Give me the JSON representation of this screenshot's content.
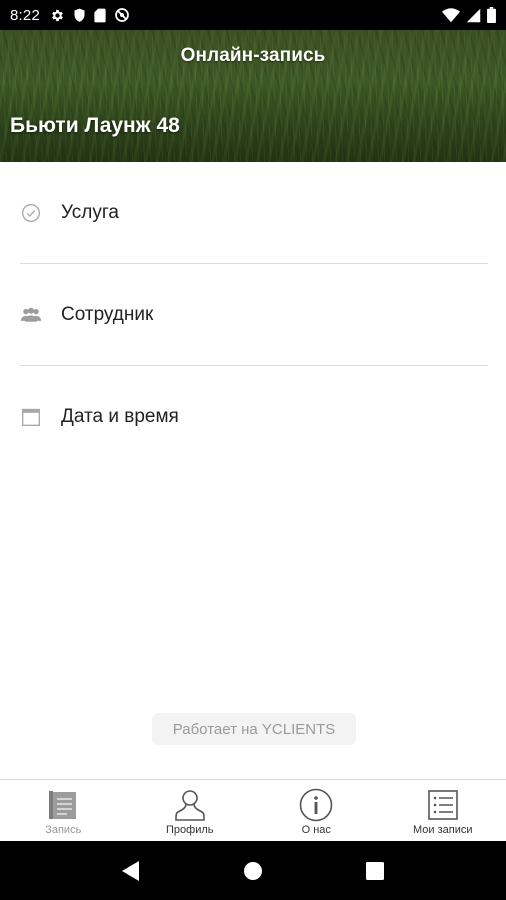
{
  "status_bar": {
    "time": "8:22",
    "left_icons": [
      "gear-icon",
      "shield-icon",
      "sd-card-icon",
      "no-sim-icon"
    ],
    "right_icons": [
      "wifi-icon",
      "signal-icon",
      "battery-icon"
    ]
  },
  "header": {
    "title": "Онлайн-запись",
    "company_name": "Бьюти Лаунж 48"
  },
  "menu": {
    "items": [
      {
        "label": "Услуга",
        "icon": "check-circle-icon"
      },
      {
        "label": "Сотрудник",
        "icon": "people-icon"
      },
      {
        "label": "Дата и время",
        "icon": "calendar-icon"
      }
    ]
  },
  "powered_by": "Работает на YCLIENTS",
  "bottom_nav": {
    "items": [
      {
        "label": "Запись",
        "icon": "book-icon",
        "active": true
      },
      {
        "label": "Профиль",
        "icon": "person-icon",
        "active": false
      },
      {
        "label": "О нас",
        "icon": "info-icon",
        "active": false
      },
      {
        "label": "Мои записи",
        "icon": "list-icon",
        "active": false
      }
    ]
  },
  "android_nav": [
    "back-icon",
    "home-icon",
    "recents-icon"
  ],
  "colors": {
    "status_bar": "#000000",
    "divider": "#dcdcdc",
    "icon_gray": "#9e9e9e",
    "nav_icon": "#555555",
    "active_nav_label": "#999999"
  }
}
